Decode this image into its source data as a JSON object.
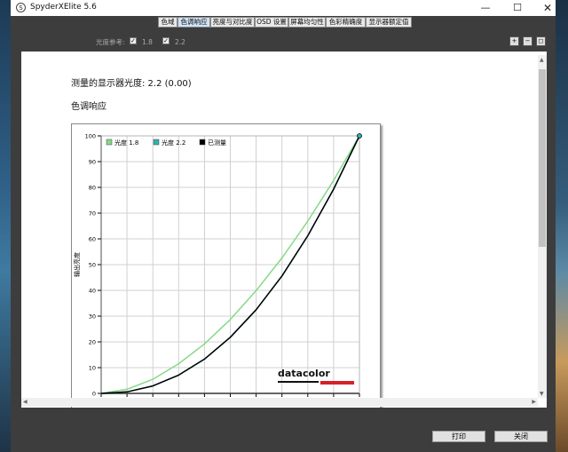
{
  "window": {
    "title": "SpyderXElite 5.6",
    "app_icon_glyph": "S",
    "minimize": "—",
    "maximize": "☐",
    "close": "✕"
  },
  "tabs": [
    {
      "label": "色域",
      "active": false
    },
    {
      "label": "色调响应",
      "active": true
    },
    {
      "label": "亮度与对比度",
      "active": false
    },
    {
      "label": "OSD 设置",
      "active": false
    },
    {
      "label": "屏幕均匀性",
      "active": false
    },
    {
      "label": "色彩精确度",
      "active": false
    },
    {
      "label": "显示器额定值",
      "active": false
    }
  ],
  "gamma_reference": {
    "label": "光度参考:",
    "options": [
      {
        "label": "1.8",
        "checked": true
      },
      {
        "label": "2.2",
        "checked": true
      }
    ]
  },
  "zoom_icons": [
    "zoom-in-icon",
    "zoom-out-icon",
    "zoom-fit-icon"
  ],
  "content": {
    "measured_gamma": "测量的显示器光度: 2.2 (0.00)",
    "section_title": "色调响应"
  },
  "chart_data": {
    "type": "line",
    "ylabel": "输出亮度",
    "ylim": [
      0,
      100
    ],
    "y_ticks": [
      "0",
      "10",
      "20",
      "30",
      "40",
      "50",
      "60",
      "70",
      "80",
      "90",
      "100"
    ],
    "x": [
      0,
      10,
      20,
      30,
      40,
      50,
      60,
      70,
      80,
      90,
      100
    ],
    "series": [
      {
        "name": "光度 1.8",
        "color": "#86d986",
        "values": [
          0,
          1.6,
          5.5,
          11.5,
          19.2,
          28.7,
          39.9,
          52.6,
          66.9,
          82.7,
          100
        ]
      },
      {
        "name": "光度 2.2",
        "color": "#2fb3b3",
        "values": [
          0,
          0.6,
          2.9,
          7.1,
          13.3,
          21.8,
          32.5,
          45.6,
          61.2,
          79.3,
          100
        ]
      },
      {
        "name": "已测量",
        "color": "#000000",
        "values": [
          0,
          0.6,
          2.9,
          7.1,
          13.3,
          21.8,
          32.5,
          45.6,
          61.2,
          79.3,
          100
        ]
      }
    ],
    "legend_position": "top-left",
    "grid": true,
    "watermark": "datacolor",
    "watermark_bar_color": "#d62027"
  },
  "footer": {
    "print": "打印",
    "close": "关闭"
  }
}
